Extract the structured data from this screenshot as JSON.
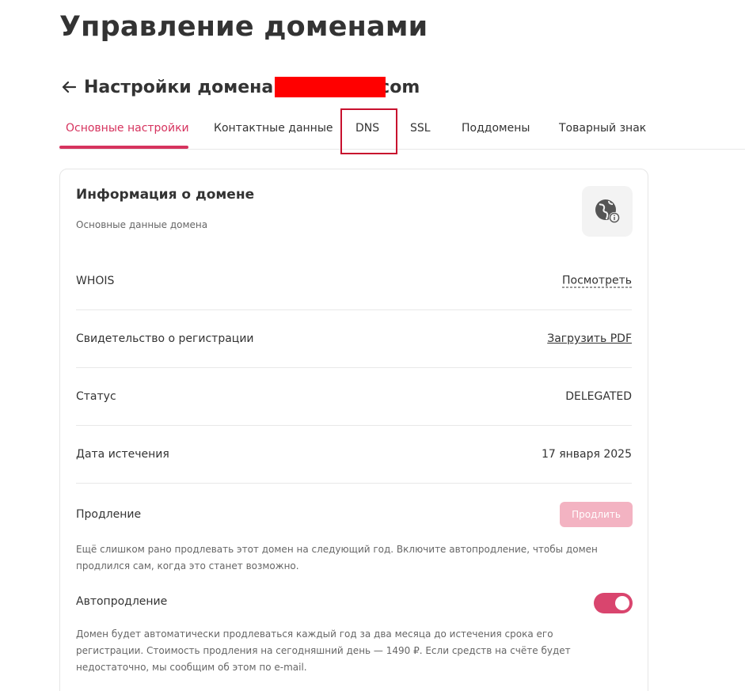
{
  "page": {
    "title": "Управление доменами"
  },
  "domain_header": {
    "prefix": "Настройки домена",
    "suffix": "com"
  },
  "tabs": [
    {
      "label": "Основные настройки",
      "active": true
    },
    {
      "label": "Контактные данные",
      "active": false
    },
    {
      "label": "DNS",
      "active": false,
      "highlighted": true
    },
    {
      "label": "SSL",
      "active": false
    },
    {
      "label": "Поддомены",
      "active": false
    },
    {
      "label": "Товарный знак",
      "active": false
    }
  ],
  "card": {
    "title": "Информация о домене",
    "subtitle": "Основные данные домена",
    "icon": "globe-info-icon",
    "rows": [
      {
        "label": "WHOIS",
        "value": "Посмотреть"
      },
      {
        "label": "Свидетельство о регистрации",
        "value": "Загрузить PDF"
      },
      {
        "label": "Статус",
        "value": "DELEGATED"
      },
      {
        "label": "Дата истечения",
        "value": "17 января 2025"
      }
    ],
    "renewal": {
      "label": "Продление",
      "button": "Продлить",
      "note": "Ещё слишком рано продлевать этот домен на следующий год. Включите автопродление, чтобы домен продлился сам, когда это станет возможно."
    },
    "autorenew": {
      "label": "Автопродление",
      "enabled": true,
      "note": "Домен будет автоматически продлеваться каждый год за два месяца до истечения срока его регистрации. Стоимость продления на сегодняшний день — 1490 ₽. Если средств на счёте будет недостаточно, мы сообщим об этом по e-mail."
    }
  },
  "colors": {
    "accent": "#d6335e",
    "toggle": "#d9456e",
    "button_disabled": "#f3b3c2",
    "highlight_box": "#c8102e",
    "redaction": "#ff0000"
  }
}
